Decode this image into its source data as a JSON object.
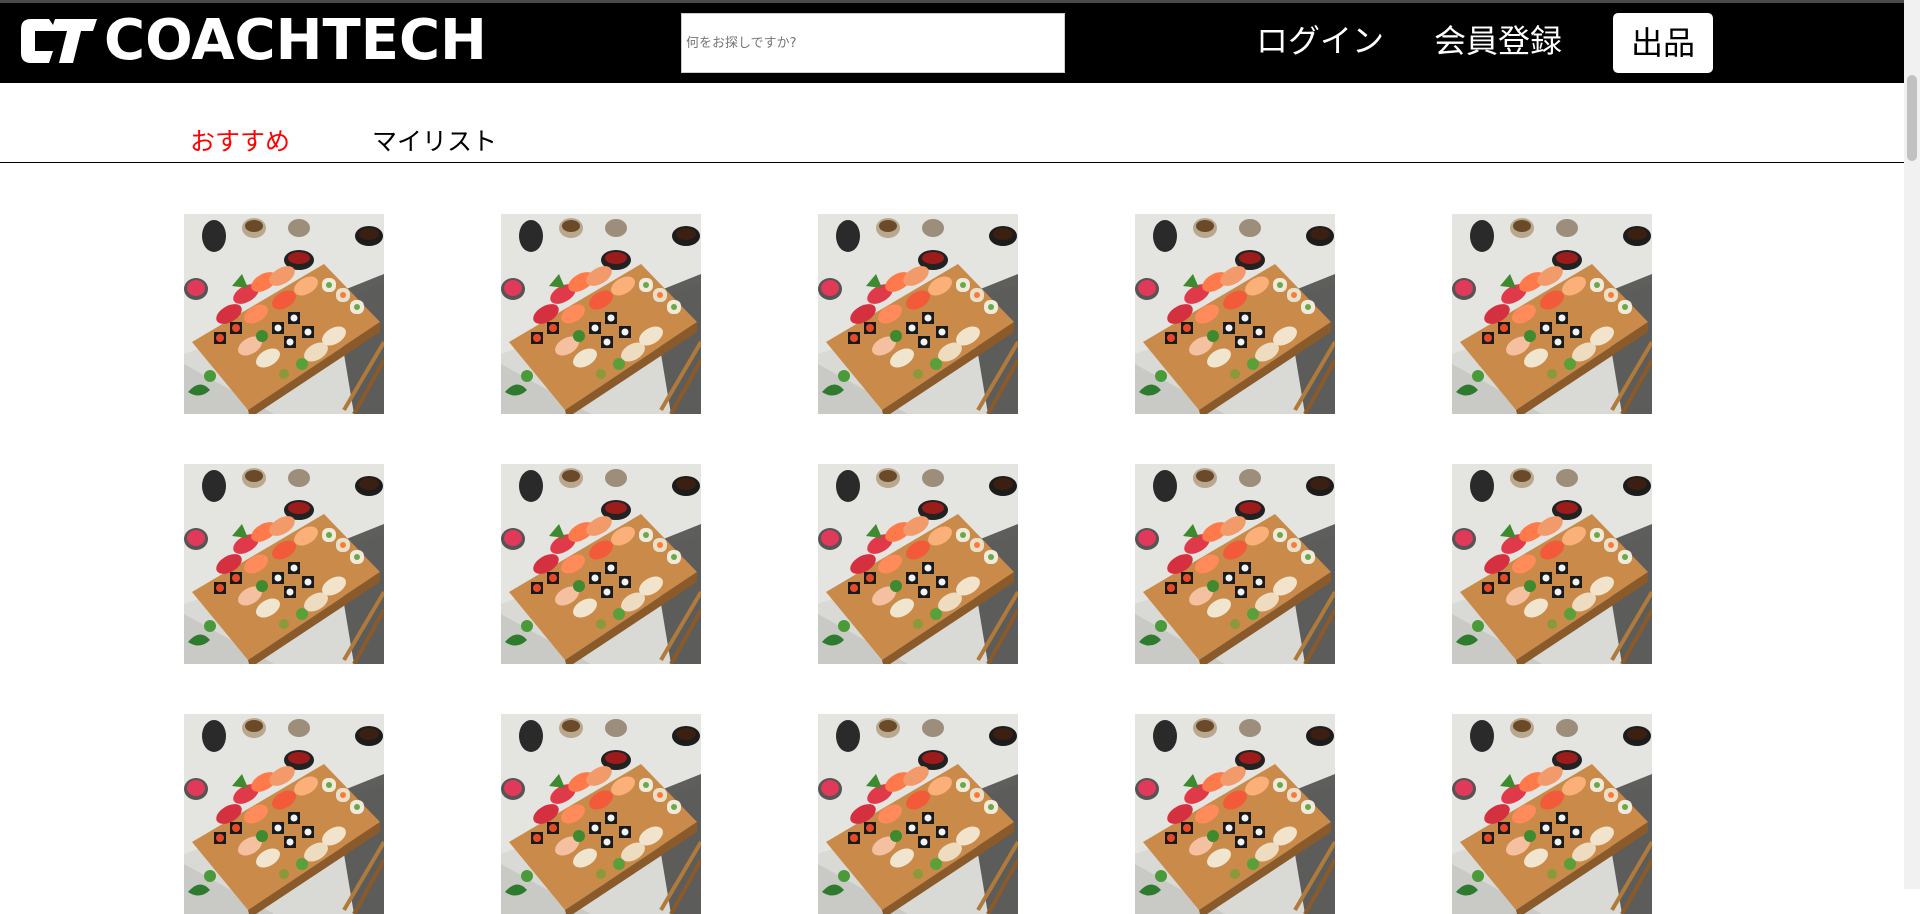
{
  "header": {
    "logo_text": "COACHTECH",
    "search": {
      "placeholder": "何をお探しですか?",
      "value": ""
    },
    "nav": {
      "login": "ログイン",
      "register": "会員登録",
      "sell": "出品"
    }
  },
  "tabs": [
    {
      "label": "おすすめ",
      "active": true
    },
    {
      "label": "マイリスト",
      "active": false
    }
  ],
  "products": [
    {
      "image": "sushi-platter"
    },
    {
      "image": "sushi-platter"
    },
    {
      "image": "sushi-platter"
    },
    {
      "image": "sushi-platter"
    },
    {
      "image": "sushi-platter"
    },
    {
      "image": "sushi-platter"
    },
    {
      "image": "sushi-platter"
    },
    {
      "image": "sushi-platter"
    },
    {
      "image": "sushi-platter"
    },
    {
      "image": "sushi-platter"
    },
    {
      "image": "sushi-platter"
    },
    {
      "image": "sushi-platter"
    },
    {
      "image": "sushi-platter"
    },
    {
      "image": "sushi-platter"
    },
    {
      "image": "sushi-platter"
    }
  ],
  "colors": {
    "header_bg": "#000000",
    "active_tab": "#ff0000",
    "text": "#000000"
  }
}
